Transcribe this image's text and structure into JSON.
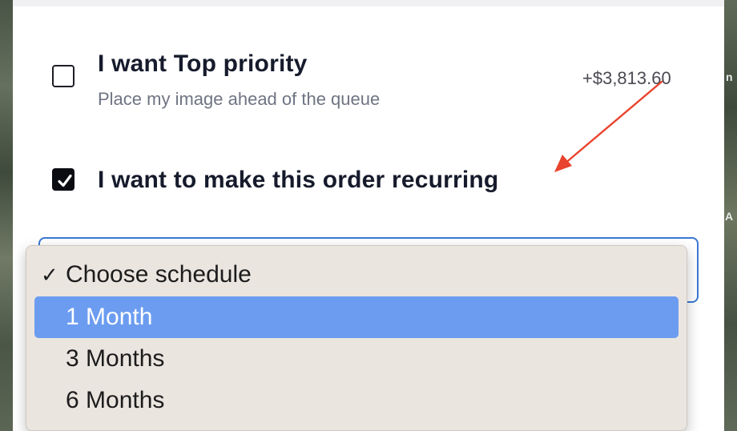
{
  "background": {
    "right_edge_text_1": "n",
    "right_edge_text_2": "A"
  },
  "options": {
    "top_priority": {
      "title": "I want Top priority",
      "subtitle": "Place my image ahead of the queue",
      "price": "+$3,813.60",
      "checked": false
    },
    "recurring": {
      "title": "I want to make this order recurring",
      "checked": true
    }
  },
  "schedule_select": {
    "selected": "Choose schedule",
    "options": [
      {
        "label": "Choose schedule",
        "checked": true,
        "highlighted": false
      },
      {
        "label": "1 Month",
        "checked": false,
        "highlighted": true
      },
      {
        "label": "3 Months",
        "checked": false,
        "highlighted": false
      },
      {
        "label": "6 Months",
        "checked": false,
        "highlighted": false
      }
    ]
  },
  "annotation": {
    "arrow_color": "#e8432e"
  },
  "colors": {
    "highlight": "#6b9cf0",
    "select_border": "#3a78d4",
    "title_text": "#161b2c"
  },
  "icons": {
    "checkmark": "checkmark-icon",
    "arrow": "annotation-arrow-icon"
  }
}
